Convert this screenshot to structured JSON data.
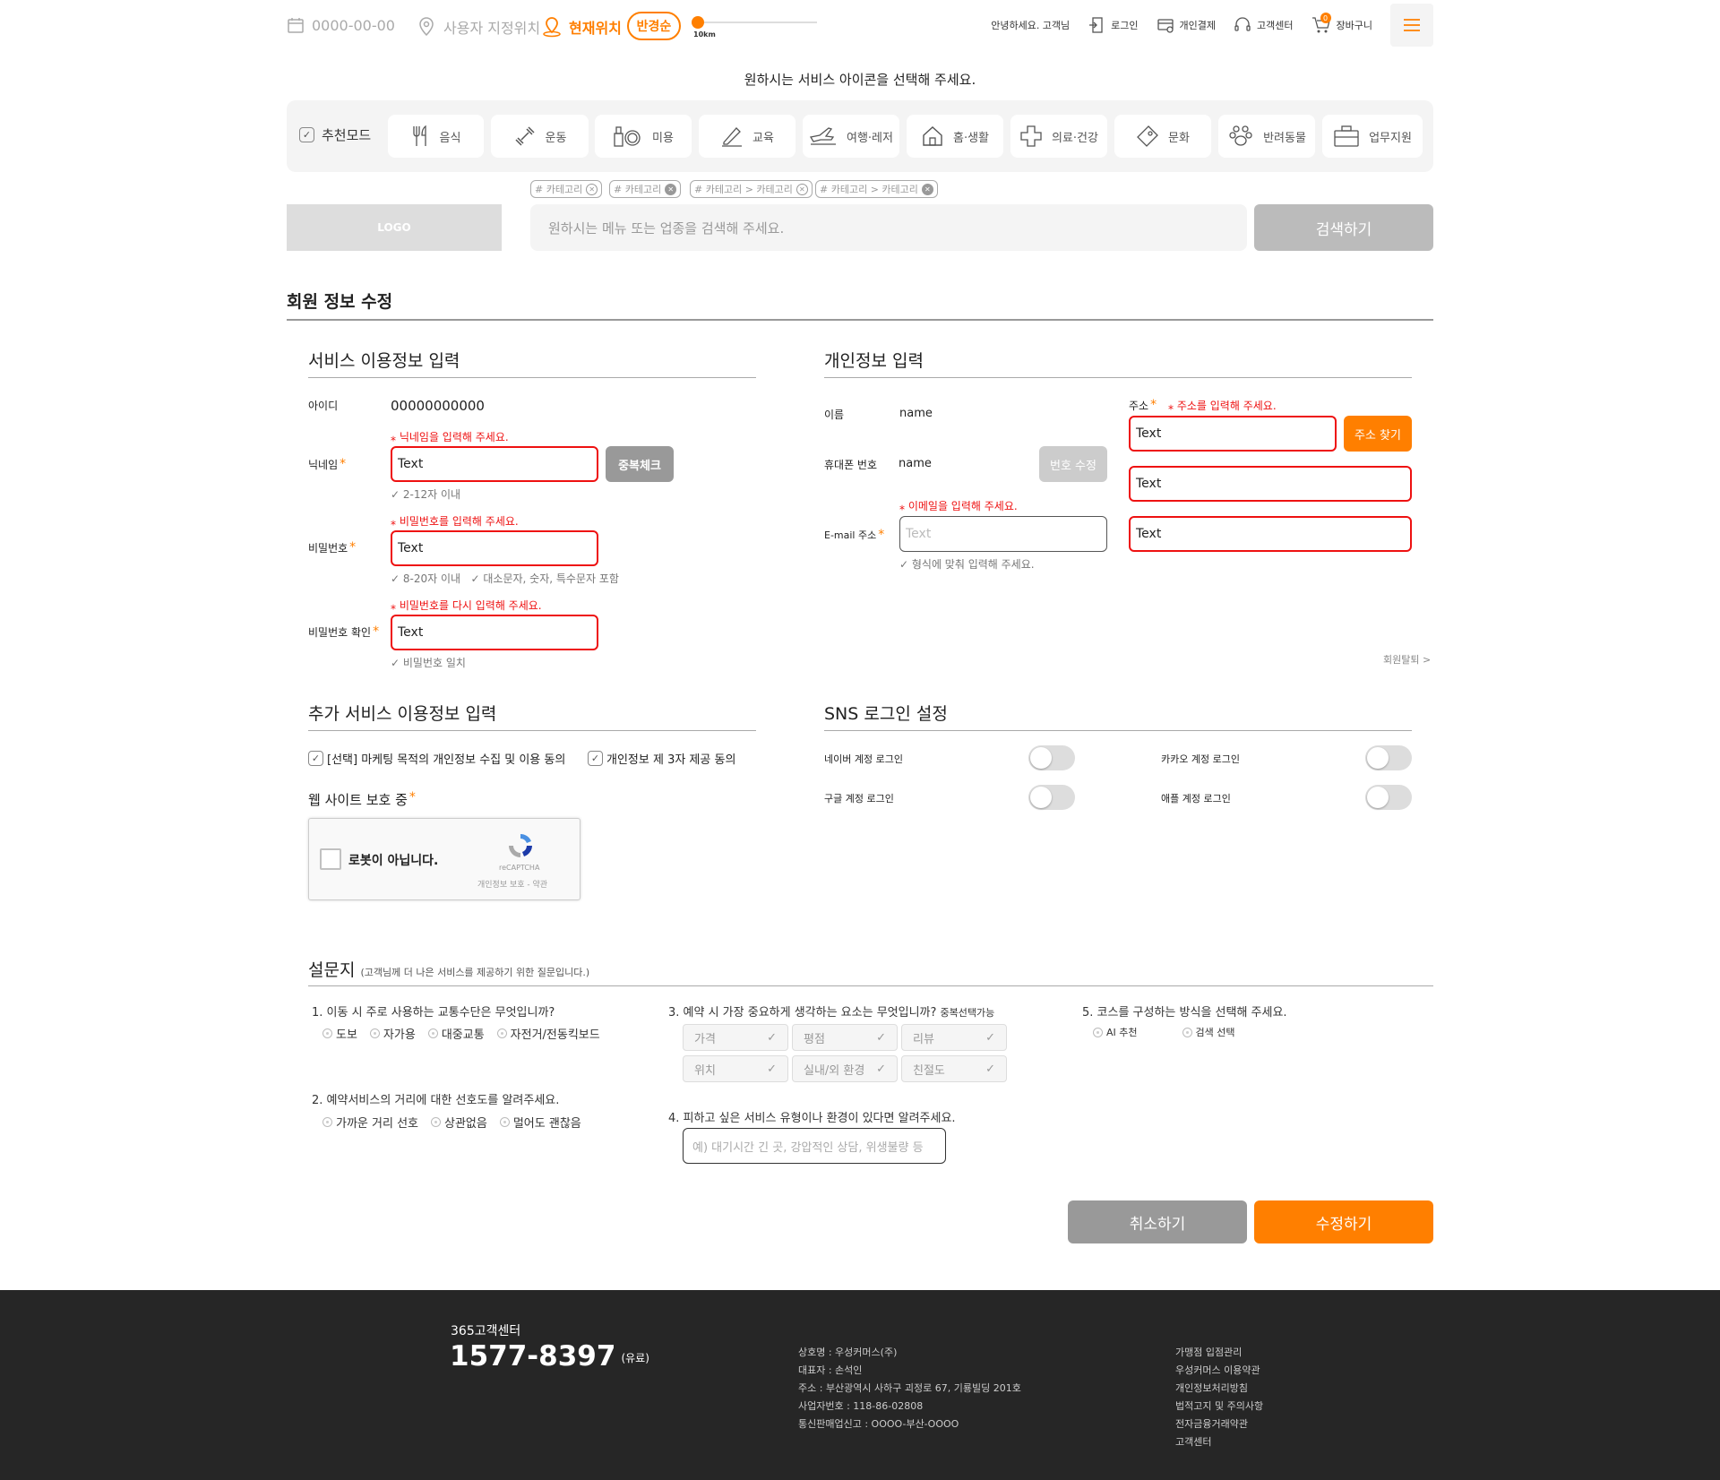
{
  "topbar": {
    "date": "0000-00-00",
    "user_location": "사용자 지정위치",
    "current_location": "현재위치",
    "sort": "반경순",
    "radius": "10km",
    "greeting": "안녕하세요. 고객님",
    "login": "로그인",
    "payment": "개인결제",
    "support": "고객센터",
    "cart": "장바구니",
    "cart_count": "0"
  },
  "prompt": "원하시는 서비스 아이콘을 선택해 주세요.",
  "categories": {
    "recommend": "추천모드",
    "items": [
      "음식",
      "운동",
      "미용",
      "교육",
      "여행·레저",
      "홈·생활",
      "의료·건강",
      "문화",
      "반려동물",
      "업무지원"
    ]
  },
  "tags": [
    "# 카테고리",
    "# 카테고리",
    "# 카테고리 > 카테고리",
    "# 카테고리 > 카테고리"
  ],
  "logo": "LOGO",
  "search": {
    "placeholder": "원하시는 메뉴 또는 업종을 검색해 주세요.",
    "button": "검색하기"
  },
  "page_title": "회원 정보 수정",
  "service": {
    "title": "서비스 이용정보 입력",
    "id_label": "아이디",
    "id_value": "00000000000",
    "nick_label": "닉네임",
    "nick_error": "닉네임을 입력해 주세요.",
    "nick_value": "Text",
    "nick_btn": "중복체크",
    "nick_hint": "2-12자 이내",
    "pw_label": "비밀번호",
    "pw_error": "비밀번호를 입력해 주세요.",
    "pw_value": "Text",
    "pw_hint1": "8-20자 이내",
    "pw_hint2": "대소문자, 숫자, 특수문자 포함",
    "pw2_label": "비밀번호 확인",
    "pw2_error": "비밀번호를 다시 입력해 주세요.",
    "pw2_value": "Text",
    "pw2_hint": "비밀번호 일치"
  },
  "personal": {
    "title": "개인정보 입력",
    "name_label": "이름",
    "name_value": "name",
    "phone_label": "휴대폰 번호",
    "phone_value": "name",
    "phone_btn": "번호 수정",
    "email_label": "E-mail 주소",
    "email_error": "이메일을 입력해 주세요.",
    "email_placeholder": "Text",
    "email_hint": "형식에 맞춰 입력해 주세요.",
    "addr_label": "주소",
    "addr_error": "주소를 입력해 주세요.",
    "addr1": "Text",
    "addr2": "Text",
    "addr3": "Text",
    "addr_btn": "주소 찾기",
    "withdraw": "회원탈퇴 >"
  },
  "extra": {
    "title": "추가 서비스 이용정보 입력",
    "agree1": "[선택] 마케팅 목적의 개인정보 수집 및 이용 동의",
    "agree2": "개인정보 제 3자 제공 동의",
    "protect": "웹 사이트 보호 중",
    "captcha_text": "로봇이 아닙니다.",
    "captcha_brand": "reCAPTCHA",
    "captcha_links": "개인정보 보호 - 약관"
  },
  "sns": {
    "title": "SNS 로그인 설정",
    "naver": "네이버 계정 로그인",
    "kakao": "카카오 계정 로그인",
    "google": "구글 계정 로그인",
    "apple": "애플 계정 로그인"
  },
  "survey": {
    "title": "설문지",
    "subtitle": "(고객님께 더 나은 서비스를 제공하기 위한 질문입니다.)",
    "q1": "1. 이동 시 주로 사용하는 교통수단은 무엇입니까?",
    "q1_opts": [
      "도보",
      "자가용",
      "대중교통",
      "자전거/전동킥보드"
    ],
    "q2": "2. 예약서비스의 거리에 대한 선호도를 알려주세요.",
    "q2_opts": [
      "가까운 거리 선호",
      "상관없음",
      "멀어도 괜찮음"
    ],
    "q3": "3. 예약 시 가장 중요하게 생각하는 요소는 무엇입니까?",
    "q3_note": "중복선택가능",
    "q3_opts": [
      "가격",
      "평점",
      "리뷰",
      "위치",
      "실내/외 환경",
      "친절도"
    ],
    "q4": "4. 피하고 싶은 서비스 유형이나 환경이 있다면 알려주세요.",
    "q4_placeholder": "예) 대기시간 긴 곳, 강압적인 상담, 위생불량 등",
    "q5": "5. 코스를 구성하는 방식을 선택해 주세요.",
    "q5_opts": [
      "AI 추천",
      "검색 선택"
    ]
  },
  "actions": {
    "cancel": "취소하기",
    "submit": "수정하기"
  },
  "footer": {
    "center": "365고객센터",
    "phone": "1577-8397",
    "paid": "(유료)",
    "company": [
      "상호명 : 우성커머스(주)",
      "대표자 : 손석인",
      "주소 : 부산광역시 사하구 괴정로 67, 기룡빌딩 201호",
      "사업자번호 : 118-86-02808",
      "통신판매업신고 : OOOO-부산-OOOO"
    ],
    "links": [
      "가맹점 입점관리",
      "우성커머스 이용약관",
      "개인정보처리방침",
      "법적고지 및 주의사항",
      "전자금융거래약관",
      "고객센터"
    ]
  },
  "colors": {
    "accent": "#ff7f00",
    "error": "#ee1111",
    "footer_bg": "#262626"
  }
}
